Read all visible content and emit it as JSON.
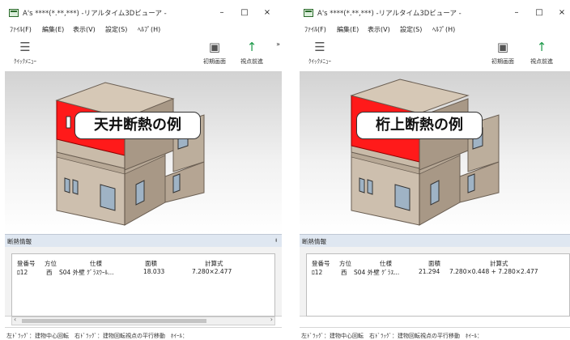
{
  "panes": [
    {
      "title": "A's ****(*.**,***) -リアルタイム3Dビューア -",
      "window_buttons": {
        "minimize": "–",
        "maximize": "□",
        "close": "×"
      },
      "menu": [
        "ﾌｧｲﾙ(F)",
        "編集(E)",
        "表示(V)",
        "設定(S)",
        "ﾍﾙﾌﾟ(H)"
      ],
      "toolbar": {
        "menu_label": "ｸｲｯｸﾒﾆｭｰ",
        "initial_label": "初期画面",
        "forward_label": "視点前進",
        "more": "»"
      },
      "callout": "天井断熱の例",
      "highlight_color": "#ff1a1a",
      "panel_title": "断熱情報",
      "pin": "ᵼ",
      "table": {
        "headers": [
          "登番号",
          "方位",
          "仕様",
          "面積",
          "計算式"
        ],
        "rows": [
          [
            "ﾛ12",
            "西",
            "S04 外壁 ｸﾞﾗｽｳｰﾙ...",
            "18.033",
            "7.280×2.477"
          ]
        ]
      },
      "scroll": {
        "left": "‹",
        "right": "›"
      },
      "status": "左ﾄﾞﾗｯｸﾞ：建物中心回転　右ﾄﾞﾗｯｸﾞ：建物回転視点の平行移動　ﾎｲｰﾙ："
    },
    {
      "title": "A's ****(*.**,***) -リアルタイム3Dビューア -",
      "window_buttons": {
        "minimize": "–",
        "maximize": "□",
        "close": "×"
      },
      "menu": [
        "ﾌｧｲﾙ(F)",
        "編集(E)",
        "表示(V)",
        "設定(S)",
        "ﾍﾙﾌﾟ(H)"
      ],
      "toolbar": {
        "menu_label": "ｸｲｯｸﾒﾆｭｰ",
        "initial_label": "初期画面",
        "forward_label": "視点前進",
        "more": "»"
      },
      "callout": "桁上断熱の例",
      "highlight_color": "#ff1a1a",
      "panel_title": "断熱情報",
      "pin": "ᵼ",
      "table": {
        "headers": [
          "登番号",
          "方位",
          "仕様",
          "面積",
          "計算式"
        ],
        "rows": [
          [
            "ﾛ12",
            "西",
            "S04 外壁 ｸﾞﾗｽ...",
            "21.294",
            "7.280×0.448 + 7.280×2.477"
          ]
        ]
      },
      "scroll": {
        "left": "‹",
        "right": "›"
      },
      "status": "左ﾄﾞﾗｯｸﾞ：建物中心回転　右ﾄﾞﾗｯｸﾞ：建物回転視点の平行移動　ﾎｲｰﾙ："
    }
  ]
}
